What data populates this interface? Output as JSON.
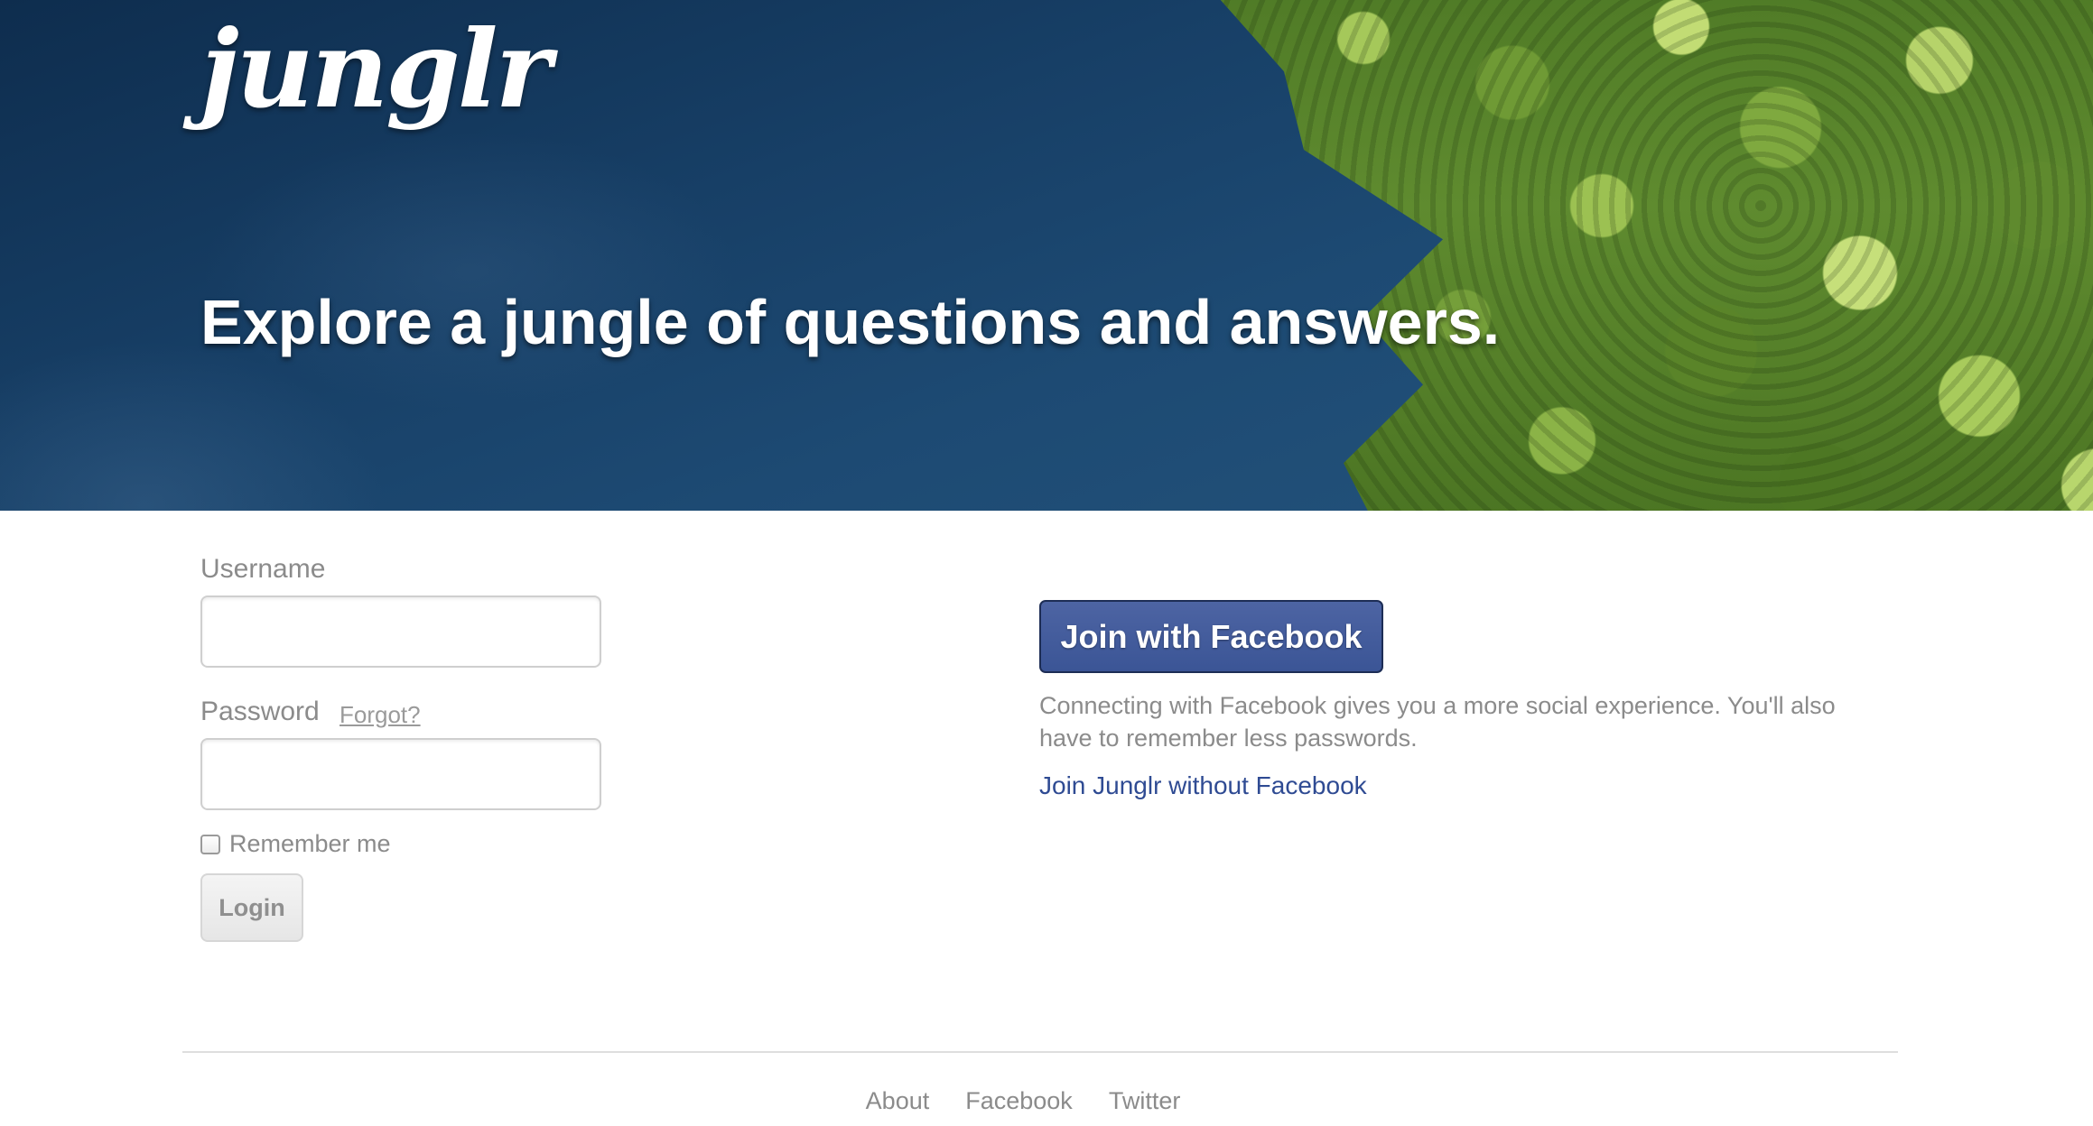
{
  "hero": {
    "logo_text": "junglr",
    "tagline": "Explore a jungle of questions and answers."
  },
  "login": {
    "username_label": "Username",
    "username_value": "",
    "password_label": "Password",
    "password_value": "",
    "forgot_label": "Forgot?",
    "remember_label": "Remember me",
    "remember_checked": false,
    "login_button": "Login"
  },
  "facebook": {
    "join_button": "Join with Facebook",
    "description": "Connecting with Facebook gives you a more social experience. You'll also have to remember less passwords.",
    "join_without_link": "Join Junglr without Facebook",
    "brand_color": "#3b5596"
  },
  "footer": {
    "links": [
      "About",
      "Facebook",
      "Twitter"
    ]
  }
}
